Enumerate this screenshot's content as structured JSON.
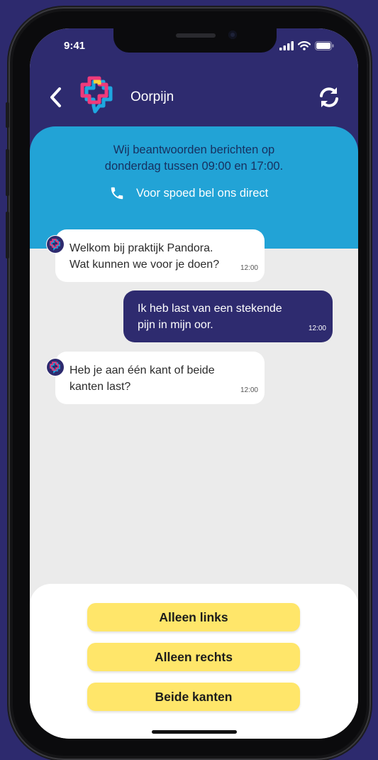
{
  "status_bar": {
    "time": "9:41"
  },
  "header": {
    "title": "Oorpijn",
    "back_icon": "chevron-left-icon",
    "refresh_icon": "refresh-icon",
    "logo": "pandora-logo"
  },
  "info_banner": {
    "line1": "Wij beantwoorden berichten op",
    "line2": "donderdag tussen 09:00 en 17:00.",
    "call_text": "Voor spoed bel ons direct",
    "call_icon": "phone-icon",
    "background": "#22a3d6"
  },
  "messages": [
    {
      "sender": "bot",
      "line1": "Welkom bij praktijk Pandora.",
      "line2": "Wat kunnen we voor je doen?",
      "time": "12:00"
    },
    {
      "sender": "user",
      "line1": "Ik heb last van een stekende",
      "line2": "pijn in mijn oor.",
      "time": "12:00"
    },
    {
      "sender": "bot",
      "line1": "Heb je aan één kant of beide",
      "line2": "kanten last?",
      "time": "12:00"
    }
  ],
  "options": [
    {
      "label": "Alleen links"
    },
    {
      "label": "Alleen rechts"
    },
    {
      "label": "Beide kanten"
    }
  ],
  "colors": {
    "brand_navy": "#2e2b6f",
    "info_blue": "#22a3d6",
    "option_yellow": "#ffe66a",
    "chat_background": "#ebebeb"
  }
}
